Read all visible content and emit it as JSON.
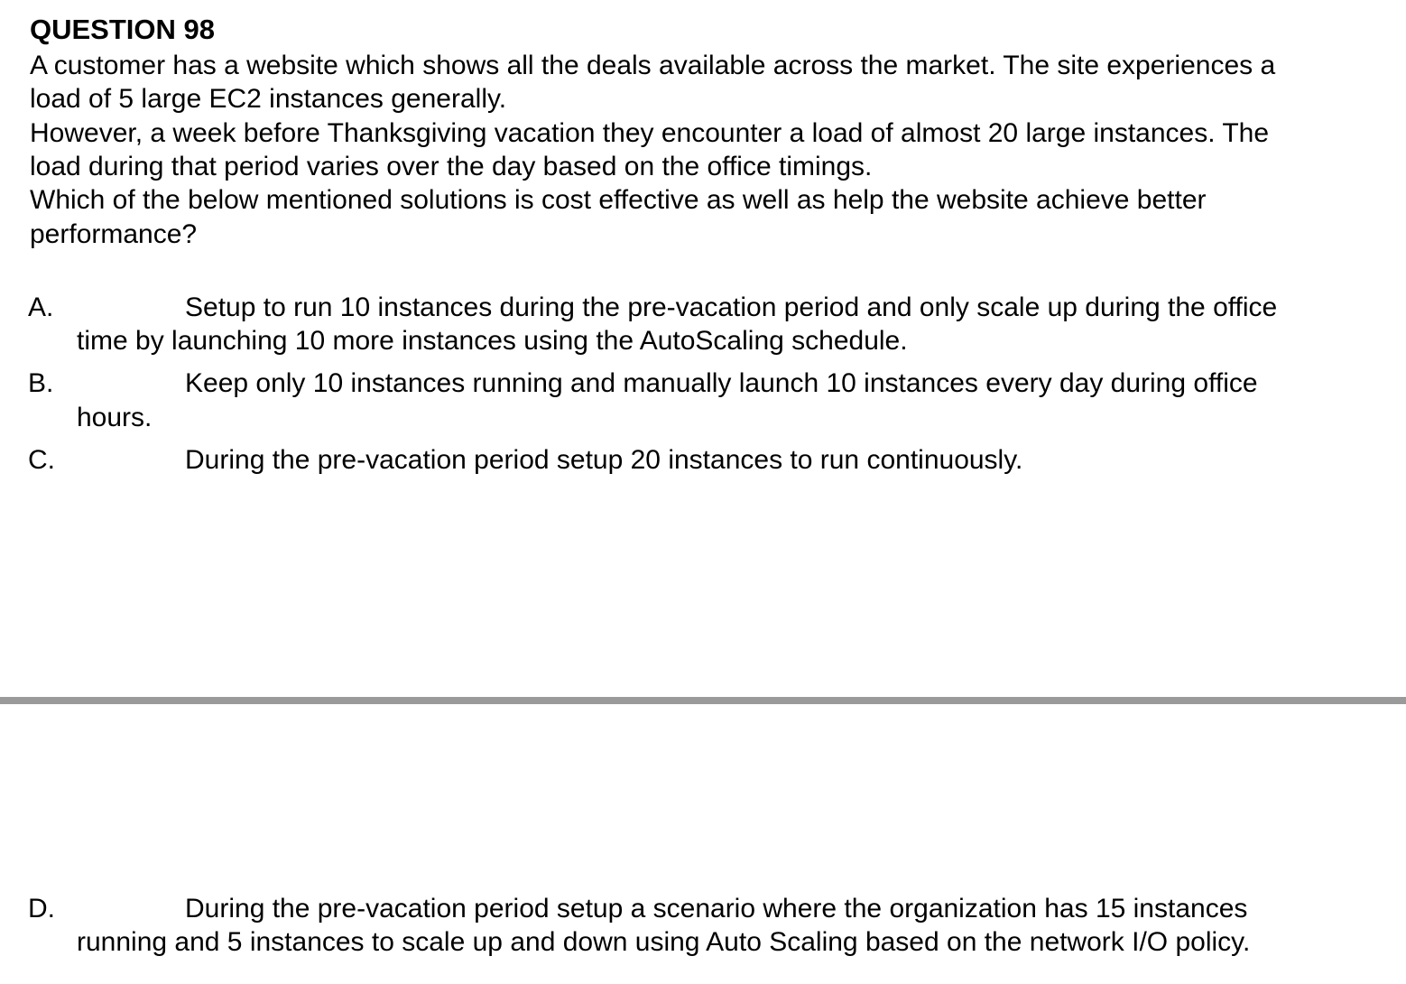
{
  "question": {
    "title": "QUESTION 98",
    "lines": [
      "A customer has a website which shows all the deals available across the market. The site experiences a",
      "load of 5 large EC2 instances generally.",
      "However, a week before Thanksgiving vacation they encounter a load of almost 20 large instances. The",
      "load during that period varies over the day based on the office timings.",
      "Which of the below mentioned solutions is cost effective as well as help the website achieve better",
      "performance?"
    ]
  },
  "options": [
    {
      "letter": "A.",
      "line1": "Setup to run 10 instances during the pre-vacation period and only scale up during the office",
      "line2": "time by launching 10 more instances using the AutoScaling schedule."
    },
    {
      "letter": "B.",
      "line1": "Keep only 10 instances running and manually launch 10 instances every day during office",
      "line2": "hours."
    },
    {
      "letter": "C.",
      "line1": "During the pre-vacation period setup 20 instances to run continuously."
    },
    {
      "letter": "D.",
      "line1": "During the pre-vacation period setup a scenario where the organization has 15 instances",
      "line2": "running and 5 instances to scale up and down using Auto Scaling based on the network I/O policy."
    }
  ]
}
